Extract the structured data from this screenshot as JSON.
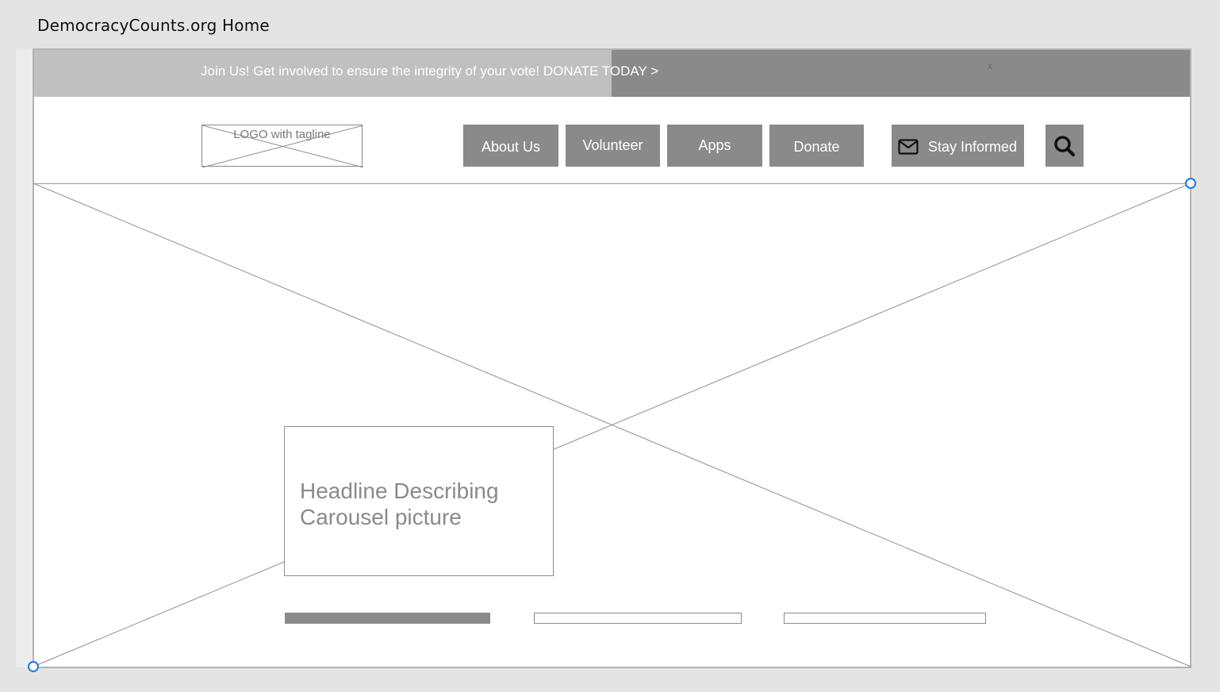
{
  "page_title": "DemocracyCounts.org Home",
  "banner": {
    "text": "Join Us! Get involved to ensure the integrity of your vote! DONATE TODAY >",
    "close_label": "x"
  },
  "header": {
    "logo_text": "LOGO with tagline",
    "nav": [
      {
        "label": "About Us"
      },
      {
        "label": "Volunteer"
      },
      {
        "label": "Apps"
      },
      {
        "label": "Donate"
      }
    ],
    "stay_informed": {
      "label": "Stay Informed",
      "icon": "envelope-icon"
    },
    "search": {
      "icon": "search-icon"
    }
  },
  "carousel": {
    "headline": "Headline Describing Carousel picture",
    "slide_count": 3,
    "active_slide": 1
  },
  "colors": {
    "button_gray": "#8a8a8a",
    "banner_light": "#c0c0c0",
    "selection_handle": "#1a7be0"
  }
}
